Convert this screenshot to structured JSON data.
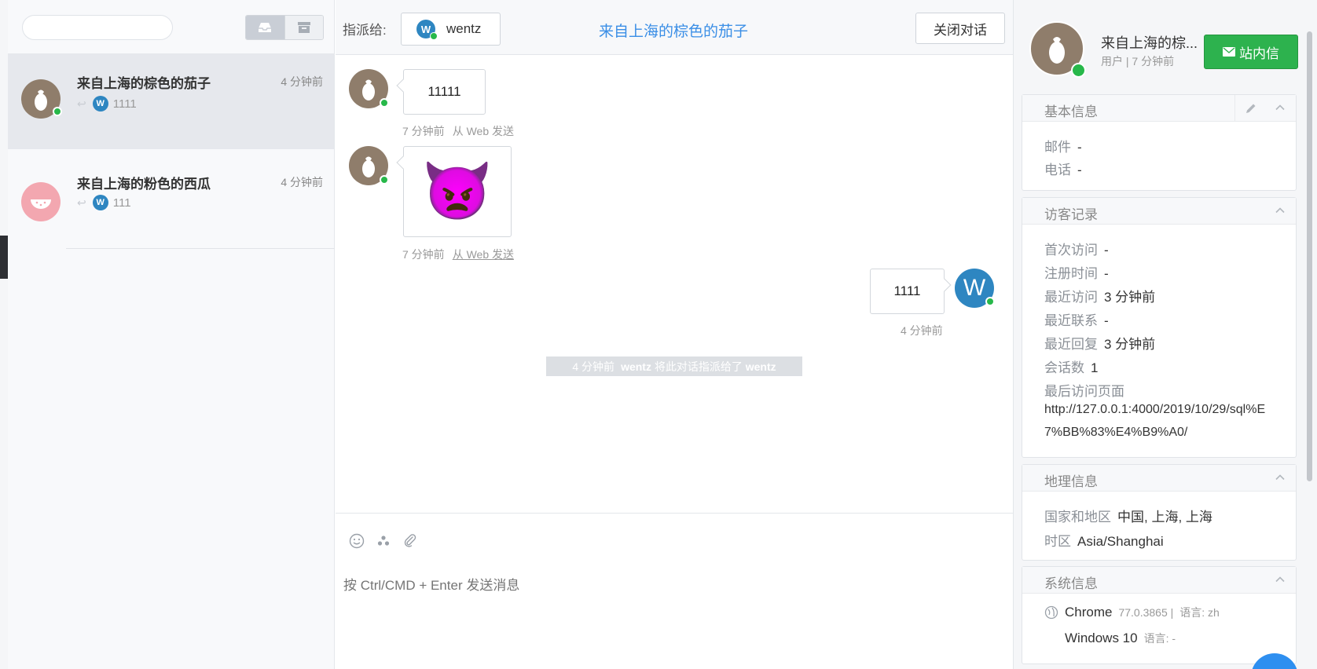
{
  "search": {
    "placeholder": ""
  },
  "filters": {
    "inbox_icon": "inbox-icon",
    "archive_icon": "archive-icon"
  },
  "conversations": [
    {
      "name": "来自上海的棕色的茄子",
      "time": "4 分钟前",
      "preview": "1111",
      "avatar": "eggplant",
      "online": true
    },
    {
      "name": "来自上海的粉色的西瓜",
      "time": "4 分钟前",
      "preview": "111",
      "avatar": "watermelon",
      "online": false
    }
  ],
  "agent": {
    "initial": "W",
    "name": "wentz"
  },
  "chat": {
    "assign_label": "指派给:",
    "title": "来自上海的棕色的茄子",
    "close_label": "关闭对话",
    "messages": [
      {
        "from": "visitor",
        "text": "11111",
        "time": "7 分钟前",
        "source": "从 Web 发送"
      },
      {
        "from": "visitor",
        "emoji": "👿",
        "time": "7 分钟前",
        "source": "从 Web 发送"
      },
      {
        "from": "agent",
        "text": "1111",
        "time": "4 分钟前"
      }
    ],
    "system_note": {
      "time": "4 分钟前",
      "actor": "wentz",
      "action": "将此对话指派给了",
      "target": "wentz"
    },
    "composer_placeholder": "按 Ctrl/CMD + Enter 发送消息"
  },
  "profile": {
    "name": "来自上海的棕...",
    "subtitle": "用户 | 7 分钟前",
    "message_button": "站内信",
    "basic": {
      "title": "基本信息",
      "rows": [
        {
          "k": "邮件",
          "v": "-"
        },
        {
          "k": "电话",
          "v": "-"
        }
      ]
    },
    "visits": {
      "title": "访客记录",
      "rows": [
        {
          "k": "首次访问",
          "v": "-"
        },
        {
          "k": "注册时间",
          "v": "-"
        },
        {
          "k": "最近访问",
          "v": "3 分钟前"
        },
        {
          "k": "最近联系",
          "v": "-"
        },
        {
          "k": "最近回复",
          "v": "3 分钟前"
        },
        {
          "k": "会话数",
          "v": "1"
        },
        {
          "k": "最后访问页面",
          "v": ""
        }
      ],
      "last_page": "http://127.0.0.1:4000/2019/10/29/sql%E7%BB%83%E4%B9%A0/"
    },
    "geo": {
      "title": "地理信息",
      "rows": [
        {
          "k": "国家和地区",
          "v": "中国, 上海, 上海"
        },
        {
          "k": "时区",
          "v": "Asia/Shanghai"
        }
      ]
    },
    "system": {
      "title": "系统信息",
      "browser": "Chrome",
      "browser_version": "77.0.3865 |",
      "browser_lang": "语言: zh",
      "os": "Windows 10",
      "os_lang": "语言: -"
    }
  },
  "colors": {
    "online": "#27b84a",
    "accent": "#3a8ee6",
    "agent_blue": "#2e86c1",
    "eggplant_bg": "#8f7d6b",
    "watermelon_bg": "#f3a7b0",
    "action_green": "#2db24e"
  }
}
